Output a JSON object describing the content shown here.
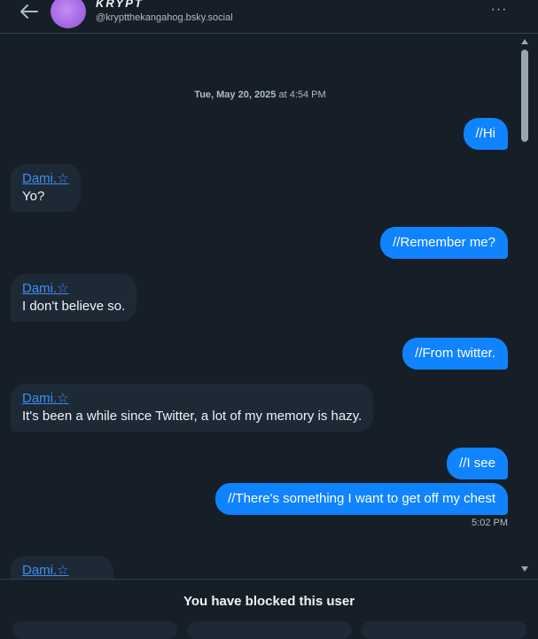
{
  "header": {
    "display_name": "KRYPT",
    "handle": "@kryptthekangahog.bsky.social",
    "back_icon": "arrow-left-icon",
    "more_icon": "ellipsis-icon",
    "more_glyph": "···"
  },
  "conversation": {
    "date_day": "Tue, May 20, 2025",
    "date_time": " at 4:54 PM",
    "messages": [
      {
        "from": "me",
        "text": "//Hi"
      },
      {
        "from": "them",
        "sender": "Dami.☆",
        "text": "Yo?"
      },
      {
        "from": "me",
        "text": "//Remember me?"
      },
      {
        "from": "them",
        "sender": "Dami.☆",
        "text": "I don't believe so."
      },
      {
        "from": "me",
        "text": "//From twitter."
      },
      {
        "from": "them",
        "sender": "Dami.☆",
        "text": "It's been a while since Twitter, a lot of my memory is hazy."
      },
      {
        "from": "me",
        "text": "//I see"
      },
      {
        "from": "me",
        "text": "//There's something I want to get off my chest"
      },
      {
        "from": "them",
        "sender": "Dami.☆",
        "text": ""
      }
    ],
    "last_sent_time": "5:02 PM"
  },
  "footer": {
    "blocked_text": "You have blocked this user"
  },
  "colors": {
    "background": "#161e27",
    "my_bubble": "#1083fe",
    "their_bubble": "#1e2936",
    "link": "#3b8ff5"
  }
}
